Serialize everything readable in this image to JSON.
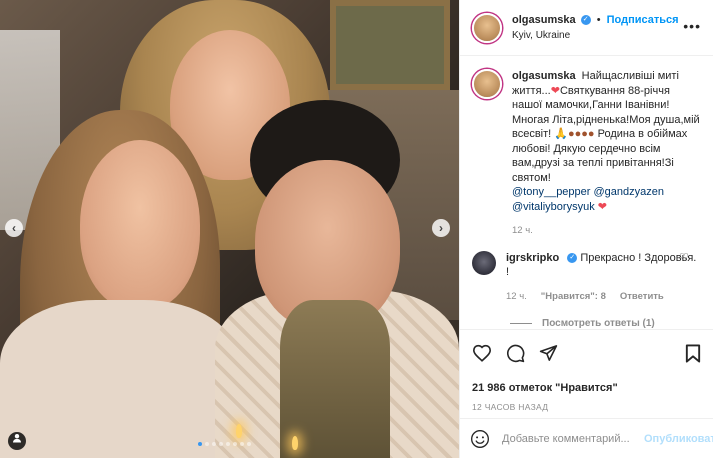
{
  "post": {
    "username": "olgasumska",
    "follow_label": "Подписаться",
    "separator": "•",
    "location": "Kyiv, Ukraine",
    "more_icon": "more-horizontal-icon"
  },
  "caption": {
    "username": "olgasumska",
    "text_1": "Найщасливіші миті життя...",
    "text_2": "Святкування 88-річчя нашої мамочки,Ганни Іванівни!Многая Літа,рідненька!Моя душа,мій всесвіт!",
    "text_3": "Родина в обіймах любові! Дякую сердечно всім вам,друзі за теплі привітання!Зі святом!",
    "mentions": [
      "@tony__pepper",
      "@gandzyazen",
      "@vitaliyborysyuk"
    ],
    "time": "12 ч."
  },
  "comment": {
    "username": "igrskripko",
    "text": "Прекрасно ! Здоровья. !",
    "time": "12 ч.",
    "likes": "\"Нравится\": 8",
    "reply_label": "Ответить",
    "view_replies": "Посмотреть ответы (1)"
  },
  "actions": {
    "likes_text": "21 986 отметок \"Нравится\"",
    "timestamp": "12 ЧАСОВ НАЗАД"
  },
  "composer": {
    "placeholder": "Добавьте комментарий...",
    "publish_label": "Опубликовать"
  },
  "colors": {
    "accent": "#0095f6",
    "verified": "#3897f0",
    "heart": "#ed4956",
    "muted": "#8e8e8e"
  }
}
